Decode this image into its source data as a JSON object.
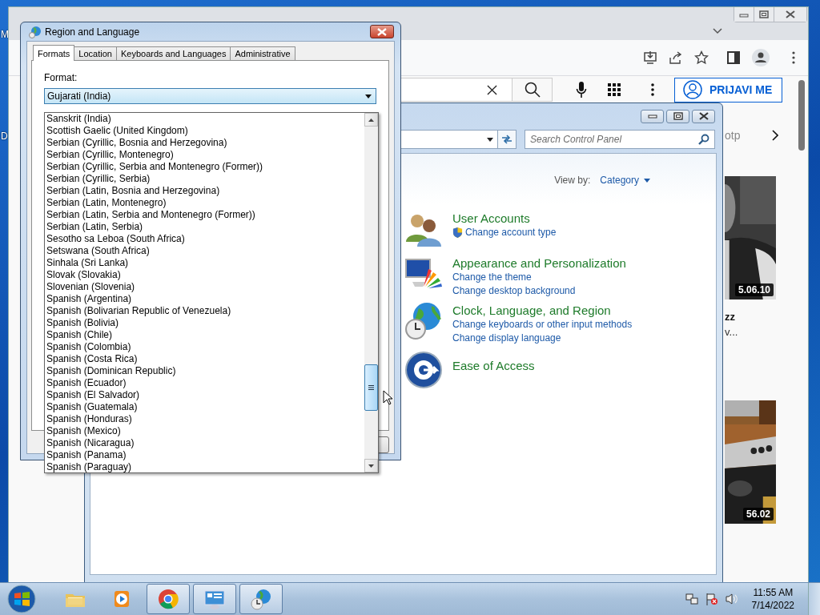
{
  "desktop": {
    "icon_labels": [
      "M",
      "D"
    ]
  },
  "browser": {
    "page": {
      "sign_in_button": "PRIJAVI ME",
      "chip": "otp",
      "videos": [
        {
          "kind": "portrait",
          "duration": "5.06.10",
          "title": "zz",
          "channel": "v..."
        },
        {
          "kind": "kitchen",
          "duration": "56.02"
        }
      ]
    }
  },
  "control_panel": {
    "search": {
      "placeholder": "Search Control Panel"
    },
    "view_by": {
      "label": "View by:",
      "value": "Category"
    },
    "categories": [
      {
        "kind": "users",
        "title": "User Accounts",
        "links": [
          {
            "text": "Change account type",
            "shield": true
          }
        ]
      },
      {
        "kind": "appearance",
        "title": "Appearance and Personalization",
        "links": [
          {
            "text": "Change the theme",
            "shield": false
          },
          {
            "text": "Change desktop background",
            "shield": false
          }
        ]
      },
      {
        "kind": "clock",
        "title": "Clock, Language, and Region",
        "links": [
          {
            "text": "Change keyboards or other input methods",
            "shield": false
          },
          {
            "text": "Change display language",
            "shield": false
          }
        ]
      },
      {
        "kind": "access",
        "title": "Ease of Access"
      }
    ]
  },
  "dialog": {
    "title": "Region and Language",
    "tabs": [
      {
        "label": "Formats",
        "selected": true
      },
      {
        "label": "Location",
        "selected": false
      },
      {
        "label": "Keyboards and Languages",
        "selected": false
      },
      {
        "label": "Administrative",
        "selected": false
      }
    ],
    "format_label": "Format:",
    "format_value": "Gujarati (India)",
    "options": [
      "Sanskrit (India)",
      "Scottish Gaelic (United Kingdom)",
      "Serbian (Cyrillic, Bosnia and Herzegovina)",
      "Serbian (Cyrillic, Montenegro)",
      "Serbian (Cyrillic, Serbia and Montenegro (Former))",
      "Serbian (Cyrillic, Serbia)",
      "Serbian (Latin, Bosnia and Herzegovina)",
      "Serbian (Latin, Montenegro)",
      "Serbian (Latin, Serbia and Montenegro (Former))",
      "Serbian (Latin, Serbia)",
      "Sesotho sa Leboa (South Africa)",
      "Setswana (South Africa)",
      "Sinhala (Sri Lanka)",
      "Slovak (Slovakia)",
      "Slovenian (Slovenia)",
      "Spanish (Argentina)",
      "Spanish (Bolivarian Republic of Venezuela)",
      "Spanish (Bolivia)",
      "Spanish (Chile)",
      "Spanish (Colombia)",
      "Spanish (Costa Rica)",
      "Spanish (Dominican Republic)",
      "Spanish (Ecuador)",
      "Spanish (El Salvador)",
      "Spanish (Guatemala)",
      "Spanish (Honduras)",
      "Spanish (Mexico)",
      "Spanish (Nicaragua)",
      "Spanish (Panama)",
      "Spanish (Paraguay)"
    ]
  },
  "taskbar": {
    "apps": [
      {
        "kind": "explorer",
        "running": false
      },
      {
        "kind": "media",
        "running": false
      },
      {
        "kind": "chrome",
        "running": true
      },
      {
        "kind": "control",
        "running": true
      },
      {
        "kind": "region",
        "running": true
      }
    ],
    "time": "11:55 AM",
    "date": "7/14/2022"
  }
}
